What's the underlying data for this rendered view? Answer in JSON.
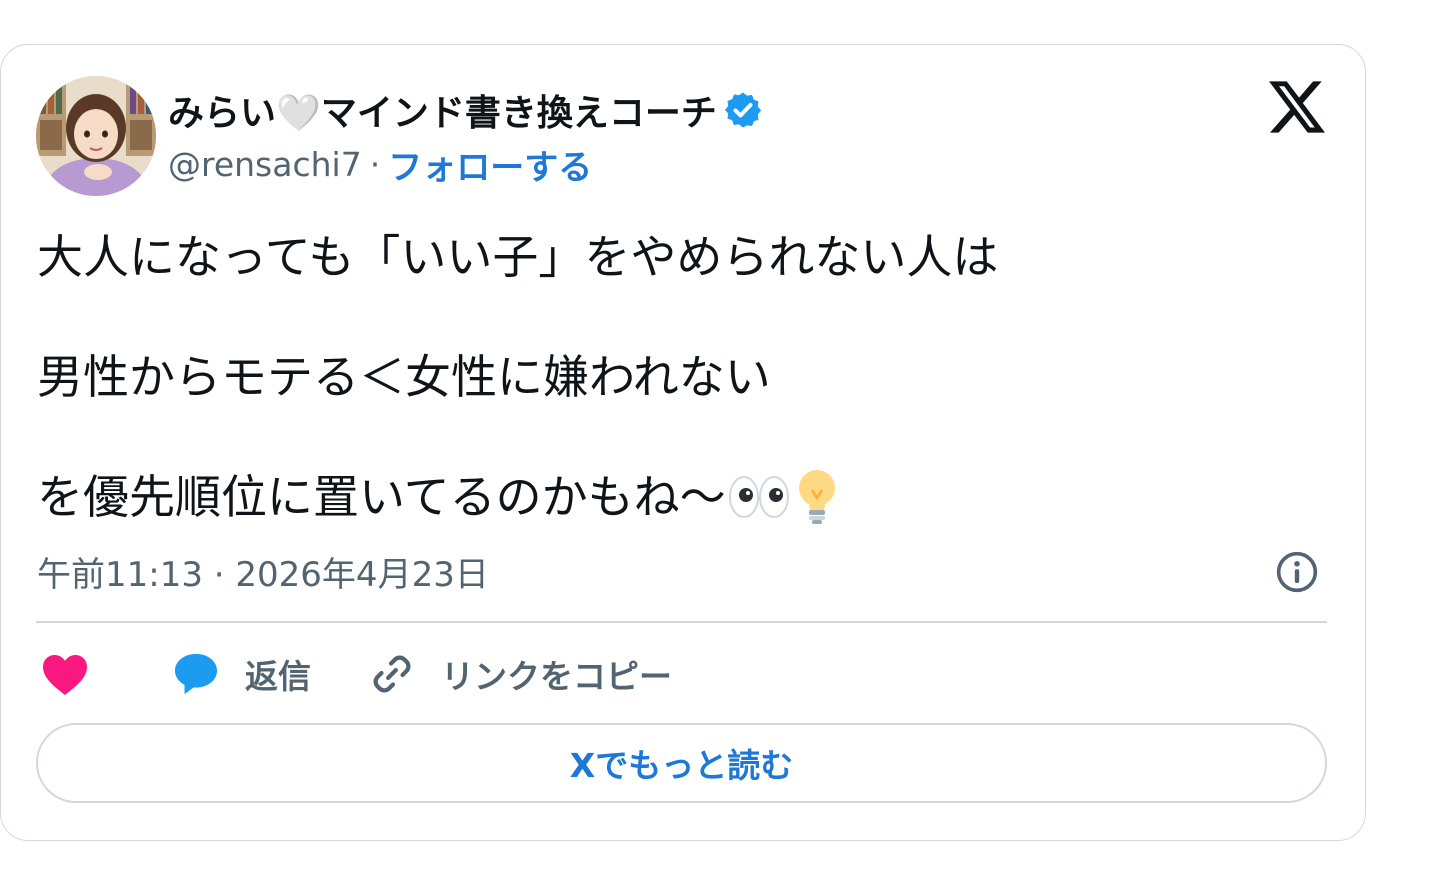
{
  "author": {
    "name": "みらい🤍マインド書き換えコーチ",
    "handle": "@rensachi7",
    "separator": "·",
    "follow_label": "フォローする"
  },
  "tweet": {
    "line1": "大人になっても「いい子」をやめられない人は",
    "line2": "男性からモテる＜女性に嫌われない",
    "line3": "を優先順位に置いてるのかもね〜",
    "timestamp": "午前11:13 · 2026年4月23日"
  },
  "actions": {
    "reply_label": "返信",
    "copy_link_label": "リンクをコピー"
  },
  "read_more_label": "Xでもっと読む",
  "colors": {
    "accent": "#1d78d6",
    "like": "#f91880",
    "reply": "#1d9bf0",
    "muted": "#536471",
    "border": "#cfd9de"
  }
}
